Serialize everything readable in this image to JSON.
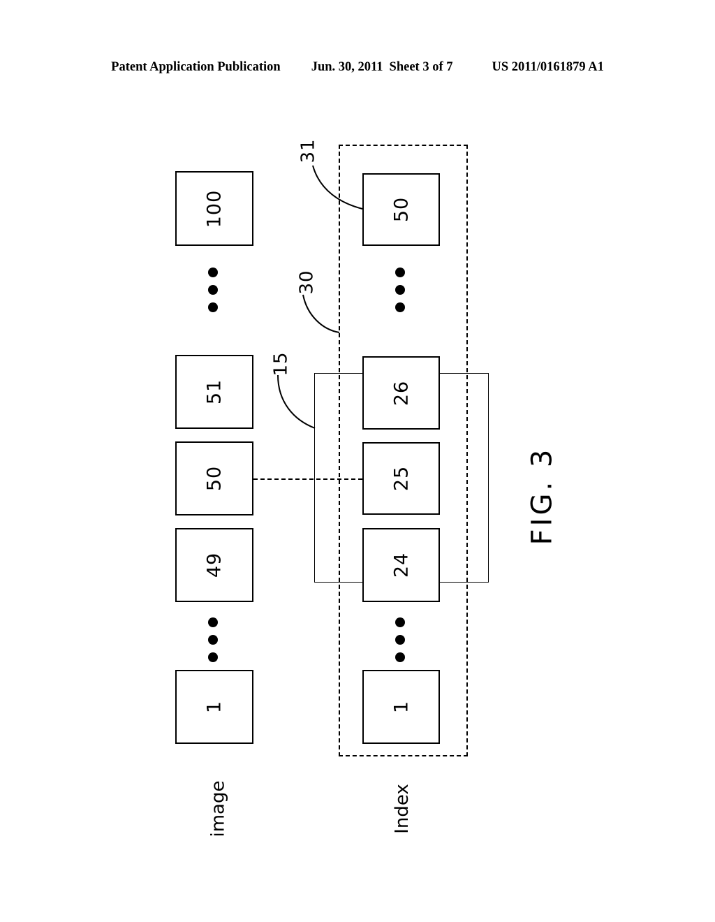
{
  "header": {
    "publication": "Patent Application Publication",
    "date": "Jun. 30, 2011",
    "sheet": "Sheet 3 of 7",
    "patent_number": "US 2011/0161879 A1"
  },
  "figure": {
    "title": "FIG. 3",
    "columns": [
      {
        "caption": "image"
      },
      {
        "caption": "Index"
      }
    ],
    "image_row": {
      "caption": "image",
      "boxes": [
        {
          "label": "100"
        },
        {
          "label": "51"
        },
        {
          "label": "50"
        },
        {
          "label": "49"
        },
        {
          "label": "1"
        }
      ]
    },
    "index_row": {
      "caption": "Index",
      "boxes": [
        {
          "label": "50"
        },
        {
          "label": "26"
        },
        {
          "label": "25"
        },
        {
          "label": "24"
        },
        {
          "label": "1"
        }
      ]
    },
    "reference_numerals": [
      {
        "label": "31",
        "points_to": "index-box-50"
      },
      {
        "label": "30",
        "points_to": "index-group-dashed"
      },
      {
        "label": "15",
        "points_to": "index-window-solid"
      }
    ],
    "ellipses_count": 3
  },
  "colors": {
    "line": "#000000",
    "background": "#ffffff"
  }
}
